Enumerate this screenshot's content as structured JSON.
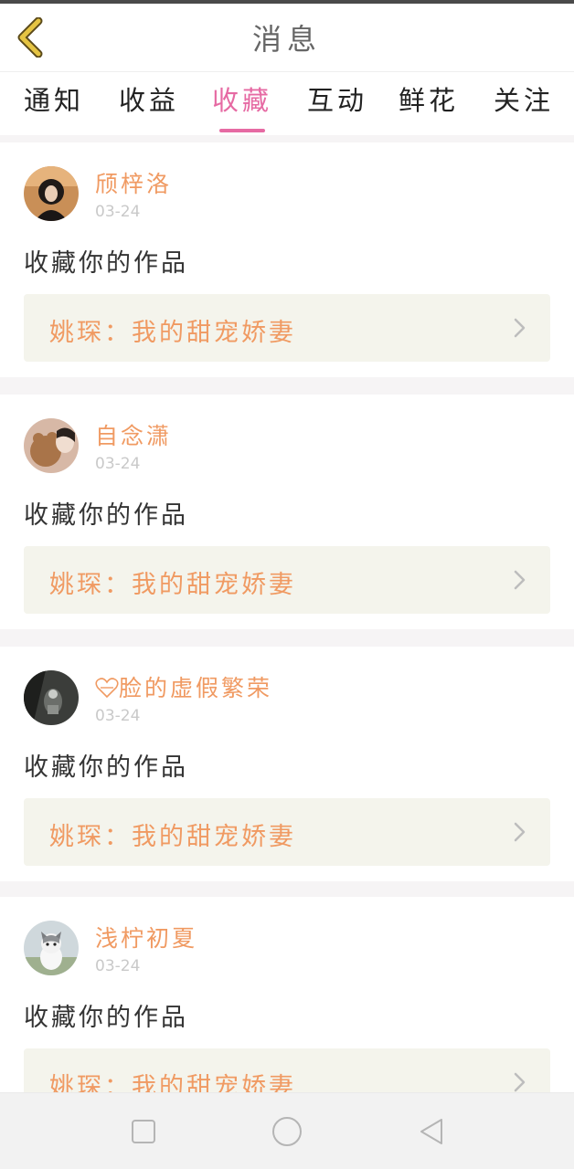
{
  "header": {
    "title": "消息"
  },
  "tabs": [
    {
      "label": "通知"
    },
    {
      "label": "收益"
    },
    {
      "label": "收藏"
    },
    {
      "label": "互动"
    },
    {
      "label": "鲜花"
    },
    {
      "label": "关注"
    }
  ],
  "active_tab_index": 2,
  "feed": [
    {
      "user": "颀梓洛",
      "date": "03-24",
      "action": "收藏你的作品",
      "work": "姚琛：我的甜宠娇妻"
    },
    {
      "user": "自念潇",
      "date": "03-24",
      "action": "收藏你的作品",
      "work": "姚琛：我的甜宠娇妻"
    },
    {
      "user": "脸的虚假繁荣",
      "date": "03-24",
      "action": "收藏你的作品",
      "work": "姚琛：我的甜宠娇妻"
    },
    {
      "user": "浅柠初夏",
      "date": "03-24",
      "action": "收藏你的作品",
      "work": "姚琛：我的甜宠娇妻"
    }
  ],
  "colors": {
    "accent": "#e66aa3",
    "orange": "#f09a62",
    "back_icon": "#e5c443"
  },
  "icons": {
    "back": "back-arrow-icon",
    "chevron": "chevron-right-icon",
    "heart": "broken-heart-icon"
  },
  "system_nav": [
    "recent-apps-icon",
    "home-icon",
    "back-triangle-icon"
  ]
}
